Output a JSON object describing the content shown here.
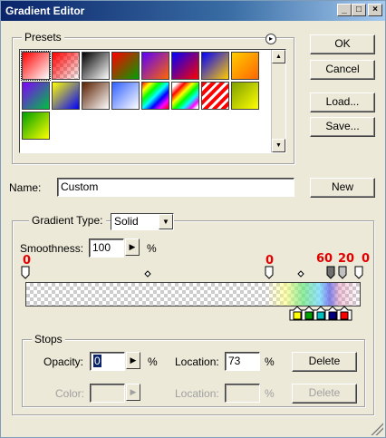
{
  "window": {
    "title": "Gradient Editor",
    "controls": [
      "_",
      "□",
      "×"
    ]
  },
  "buttons": {
    "ok": "OK",
    "cancel": "Cancel",
    "load": "Load...",
    "save": "Save...",
    "new": "New"
  },
  "presets": {
    "label": "Presets",
    "swatches": [
      [
        "#ff0000",
        "#ffffff"
      ],
      [
        "#ff0000",
        "transparent"
      ],
      [
        "#000000",
        "#ffffff"
      ],
      [
        "#ff0000",
        "#00a000"
      ],
      [
        "#5a00ff",
        "#ff6600"
      ],
      [
        "#0000ff",
        "#ff0000"
      ],
      [
        "#0000ff",
        "#ffcc00"
      ],
      [
        "#ffcc00",
        "#ff6600"
      ],
      [
        "#8000ff",
        "#00c040"
      ],
      [
        "#ffff00",
        "#0000ff"
      ],
      [
        "#5a2000",
        "#ffffff"
      ],
      [
        "#3060ff",
        "#ffffff"
      ],
      [
        "rainbow",
        "rainbow"
      ],
      [
        "rainbow2",
        "rainbow2"
      ],
      [
        "#ff0000",
        "stripes"
      ],
      [
        "#80a000",
        "#ffff00"
      ],
      [
        "#00a000",
        "#ffff00"
      ]
    ]
  },
  "name": {
    "label": "Name:",
    "value": "Custom"
  },
  "gradient": {
    "type_label": "Gradient Type:",
    "type_value": "Solid",
    "smoothness_label": "Smoothness:",
    "smoothness_value": "100",
    "percent": "%",
    "opacity_marks": [
      "0",
      "0",
      "60",
      "20",
      "0"
    ]
  },
  "stops": {
    "label": "Stops",
    "opacity_label": "Opacity:",
    "opacity_value": "0",
    "location_label": "Location:",
    "location_value": "73",
    "percent": "%",
    "delete": "Delete",
    "color_label": "Color:",
    "color_location_label": "Location:",
    "color_location_value": "",
    "color_delete": "Delete"
  },
  "colors": {
    "title_start": "#0a246a",
    "accent": "#3a6ea5",
    "stop_colors": [
      "#ffff00",
      "#00a000",
      "#00c0c0",
      "#000080",
      "#ff0000"
    ]
  }
}
